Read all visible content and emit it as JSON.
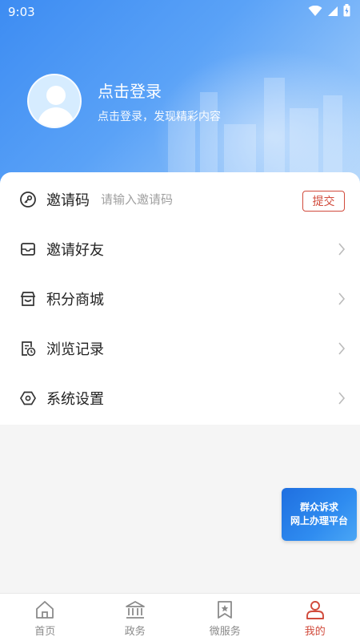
{
  "status_bar": {
    "time": "9:03"
  },
  "profile": {
    "title": "点击登录",
    "subtitle": "点击登录，发现精彩内容"
  },
  "invite": {
    "label": "邀请码",
    "placeholder": "请输入邀请码",
    "submit_label": "提交"
  },
  "menu": [
    {
      "label": "邀请好友",
      "icon": "mail-icon"
    },
    {
      "label": "积分商城",
      "icon": "store-icon"
    },
    {
      "label": "浏览记录",
      "icon": "history-icon"
    },
    {
      "label": "系统设置",
      "icon": "settings-icon"
    }
  ],
  "promo": {
    "line1": "群众诉求",
    "line2": "网上办理平台"
  },
  "tabs": [
    {
      "label": "首页",
      "icon": "home-icon"
    },
    {
      "label": "政务",
      "icon": "government-icon"
    },
    {
      "label": "微服务",
      "icon": "bookmark-star-icon"
    },
    {
      "label": "我的",
      "icon": "user-icon",
      "active": true
    }
  ],
  "colors": {
    "accent": "#d14b3c",
    "header_blue": "#3d8cf2",
    "promo_blue": "#1f6fe0"
  }
}
